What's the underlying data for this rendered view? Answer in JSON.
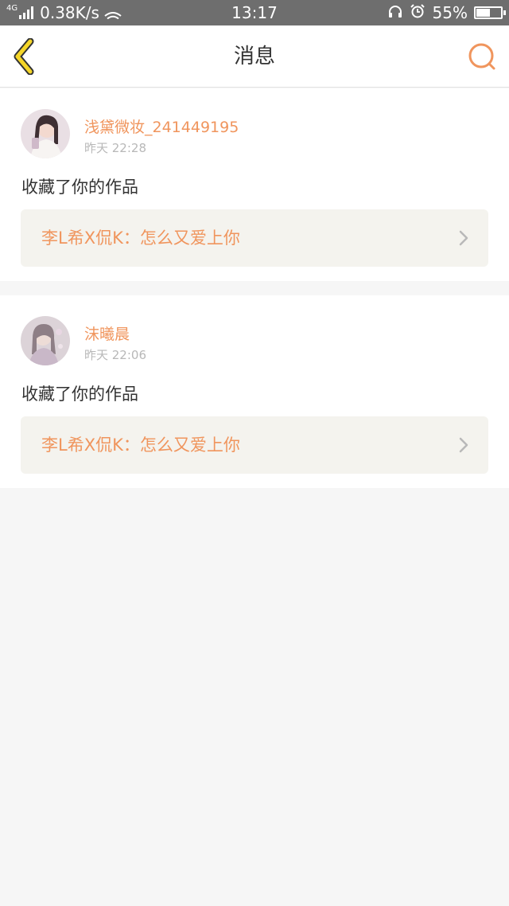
{
  "status_bar": {
    "network": "4G",
    "speed": "0.38K/s",
    "time": "13:17",
    "battery_percent": "55%",
    "battery_level": 0.55,
    "icons": [
      "signal-icon",
      "wifi-icon",
      "headset-icon",
      "alarm-icon",
      "battery-icon"
    ]
  },
  "nav": {
    "title": "消息",
    "back_icon": "back-chevron-icon",
    "search_icon": "search-icon",
    "colors": {
      "back": "#f5d629",
      "search": "#f0955d"
    }
  },
  "messages": [
    {
      "username": "浅黛微妆_241449195",
      "time": "昨天 22:28",
      "action": "收藏了你的作品",
      "work_title": "李L希X侃K：怎么又爱上你"
    },
    {
      "username": "沫曦晨",
      "time": "昨天 22:06",
      "action": "收藏了你的作品",
      "work_title": "李L希X侃K：怎么又爱上你"
    }
  ],
  "colors": {
    "accent": "#f0955d",
    "background": "#f6f6f6",
    "work_box": "#f4f3ee"
  }
}
